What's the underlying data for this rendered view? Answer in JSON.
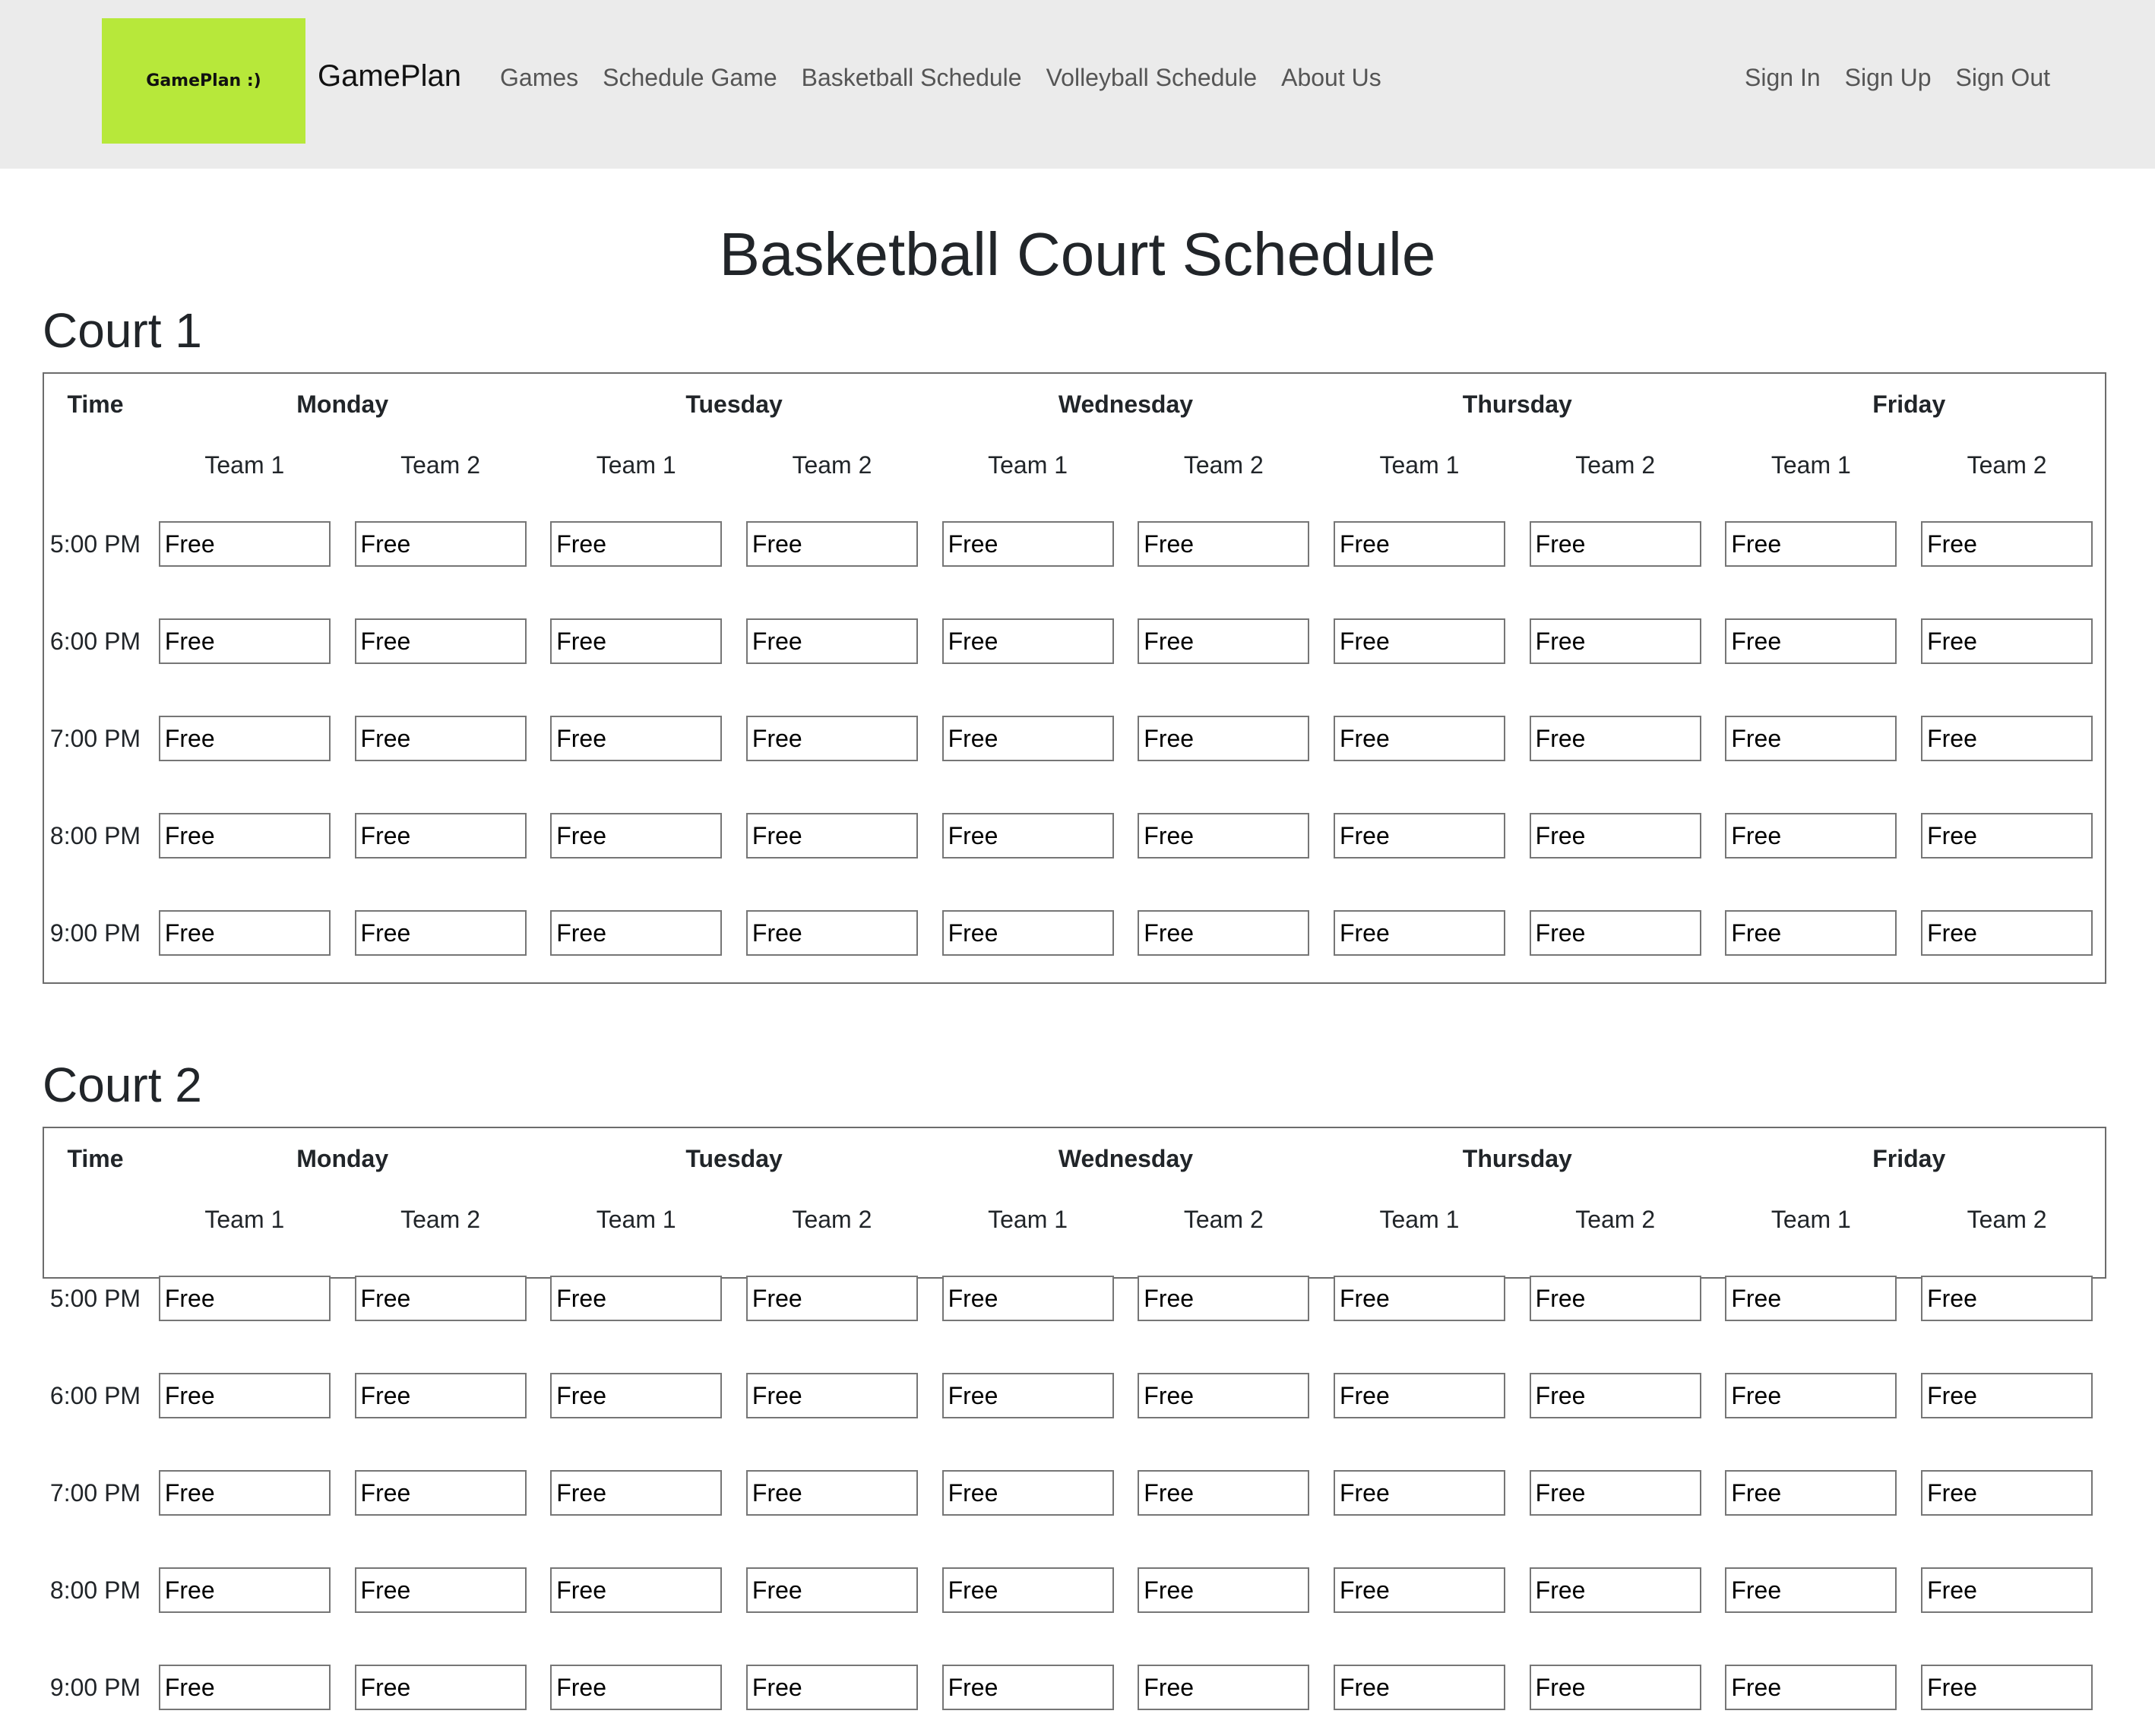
{
  "navbar": {
    "logo_text": "GamePlan :)",
    "brand": "GamePlan",
    "links": [
      "Games",
      "Schedule Game",
      "Basketball Schedule",
      "Volleyball Schedule",
      "About Us"
    ],
    "auth": [
      "Sign In",
      "Sign Up",
      "Sign Out"
    ]
  },
  "page": {
    "title": "Basketball Court Schedule"
  },
  "schedule": {
    "time_header": "Time",
    "days": [
      "Monday",
      "Tuesday",
      "Wednesday",
      "Thursday",
      "Friday"
    ],
    "team_labels": [
      "Team 1",
      "Team 2"
    ],
    "times": [
      "5:00 PM",
      "6:00 PM",
      "7:00 PM",
      "8:00 PM",
      "9:00 PM"
    ],
    "slot_value": "Free"
  },
  "courts": [
    {
      "title": "Court 1"
    },
    {
      "title": "Court 2"
    }
  ],
  "colors": {
    "navbar_bg": "#ebebeb",
    "logo_bg": "#b7e83a"
  }
}
